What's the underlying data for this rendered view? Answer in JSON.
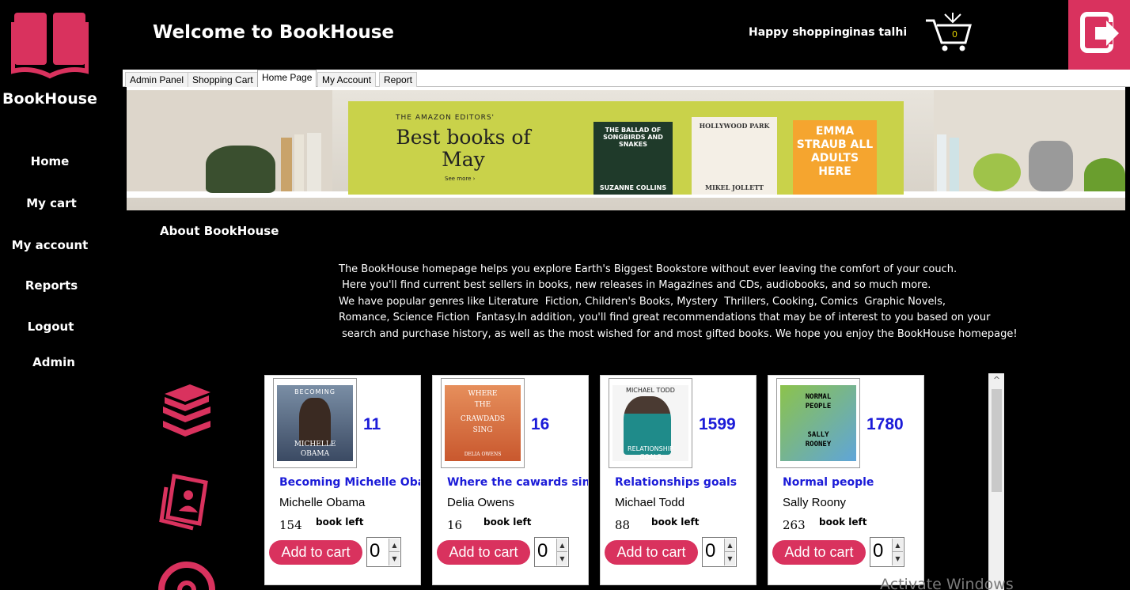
{
  "brand": {
    "name": "BookHouse"
  },
  "sidebar": {
    "items": [
      {
        "label": "Home"
      },
      {
        "label": "My cart"
      },
      {
        "label": "My account"
      },
      {
        "label": "Reports"
      },
      {
        "label": "Logout"
      },
      {
        "label": "Admin"
      }
    ]
  },
  "header": {
    "welcome": "Welcome to BookHouse",
    "greeting": "Happy shopping",
    "username": "inas talhi",
    "cart_count": "0"
  },
  "tabs": [
    {
      "label": "Admin Panel"
    },
    {
      "label": "Shopping Cart"
    },
    {
      "label": "Home Page",
      "active": true
    },
    {
      "label": "My Account"
    },
    {
      "label": "Report"
    }
  ],
  "banner": {
    "small": "THE AMAZON EDITORS'",
    "title": "Best books of May",
    "link": "See more ›",
    "covers": [
      {
        "title": "THE BALLAD OF SONGBIRDS AND SNAKES",
        "author": "SUZANNE COLLINS"
      },
      {
        "title": "HOLLYWOOD PARK",
        "author": "MIKEL JOLLETT"
      },
      {
        "title": "EMMA STRAUB ALL ADULTS HERE",
        "author": ""
      }
    ]
  },
  "about": {
    "title": "About BookHouse",
    "text": "The BookHouse homepage helps you explore Earth's Biggest Bookstore without ever leaving the comfort of your couch.\n Here you'll find current best sellers in books, new releases in Magazines and CDs, audiobooks, and so much more.\nWe have popular genres like Literature  Fiction, Children's Books, Mystery  Thrillers, Cooking, Comics  Graphic Novels,\nRomance, Science Fiction  Fantasy.In addition, you'll find great recommendations that may be of interest to you based on your\n search and purchase history, as well as the most wished for and most gifted books. We hope you enjoy the BookHouse homepage!"
  },
  "products": [
    {
      "id": "11",
      "title": "Becoming Michelle Obama",
      "author": "Michelle Obama",
      "stock": "154",
      "left_label": "book left",
      "button": "Add to cart",
      "qty": "0",
      "cover_text": [
        "BECOMING",
        "MICHELLE",
        "OBAMA"
      ]
    },
    {
      "id": "16",
      "title": "Where the cawards sing",
      "author": "Delia Owens",
      "stock": "16",
      "left_label": "book left",
      "button": "Add to cart",
      "qty": "0",
      "cover_text": [
        "WHERE",
        "THE",
        "CRAWDADS",
        "SING",
        "DELIA OWENS"
      ]
    },
    {
      "id": "1599",
      "title": "Relationships goals",
      "author": "Michael Todd",
      "stock": "88",
      "left_label": "book left",
      "button": "Add to cart",
      "qty": "0",
      "cover_text": [
        "MICHAEL TODD",
        "RELATIONSHIP",
        "GOALS"
      ]
    },
    {
      "id": "1780",
      "title": "Normal people",
      "author": "Sally Roony",
      "stock": "263",
      "left_label": "book left",
      "button": "Add to cart",
      "qty": "0",
      "cover_text": [
        "NORMAL",
        "PEOPLE",
        "SALLY",
        "ROONEY"
      ]
    }
  ],
  "watermark": "Activate Windows",
  "colors": {
    "accent": "#d9325e",
    "link_blue": "#1b1bd8",
    "background": "#000000"
  },
  "icons": [
    "open-book-logo-icon",
    "shopping-cart-icon",
    "exit-icon",
    "book-stack-icon",
    "magazine-icon",
    "cd-disc-icon"
  ]
}
